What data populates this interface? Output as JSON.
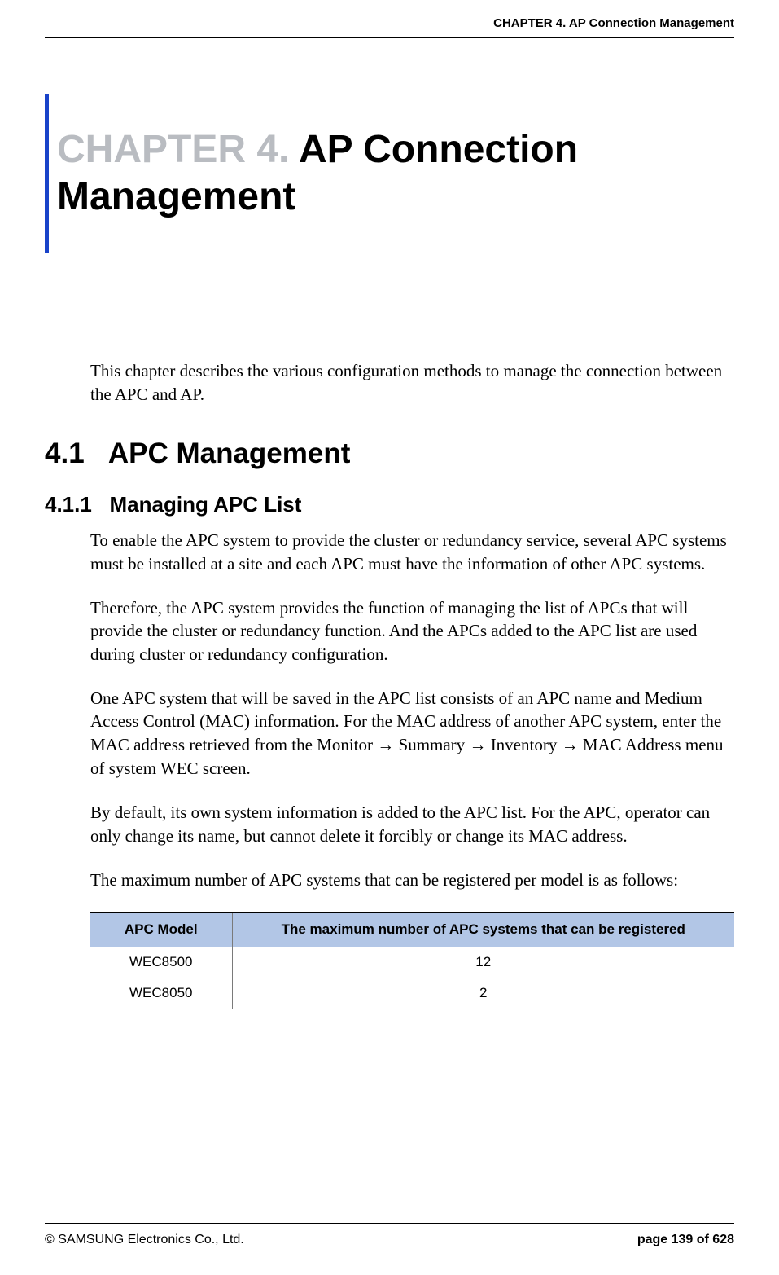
{
  "header": {
    "running_title": "CHAPTER 4. AP Connection Management"
  },
  "chapter": {
    "number_label": "CHAPTER 4.",
    "title_text": "AP Connection Management"
  },
  "content": {
    "intro": "This chapter describes the various configuration methods to manage the connection between the APC and AP.",
    "section_4_1_number": "4.1",
    "section_4_1_title": "APC Management",
    "section_4_1_1_number": "4.1.1",
    "section_4_1_1_title": "Managing APC List",
    "para1": "To enable the APC system to provide the cluster or redundancy service, several APC systems must be installed at a site and each APC must have the information of other APC systems.",
    "para2": "Therefore, the APC system provides the function of managing the list of APCs that will provide the cluster or redundancy function. And the APCs added to the APC list are used during cluster or redundancy configuration.",
    "para3_part1": "One APC system that will be saved in the APC list consists of an APC name and Medium Access Control (MAC) information. For the MAC address of another APC system, enter the MAC address retrieved from the Monitor ",
    "para3_arrow": "→",
    "para3_part2": " Summary ",
    "para3_part3": " Inventory ",
    "para3_part4": " MAC Address menu of system WEC screen.",
    "para4": "By default, its own system information is added to the APC list. For the APC, operator can only change its name, but cannot delete it forcibly or change its MAC address.",
    "para5": "The maximum number of APC systems that can be registered per model is as follows:"
  },
  "table": {
    "headers": {
      "col1": "APC Model",
      "col2": "The maximum number of APC systems that can be registered"
    },
    "rows": [
      {
        "model": "WEC8500",
        "max": "12"
      },
      {
        "model": "WEC8050",
        "max": "2"
      }
    ]
  },
  "footer": {
    "copyright": "© SAMSUNG Electronics Co., Ltd.",
    "page_info": "page 139 of 628"
  }
}
